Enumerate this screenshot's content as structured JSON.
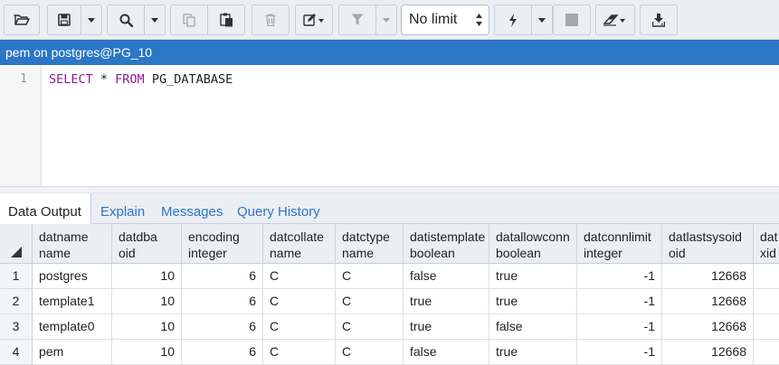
{
  "toolbar": {
    "buttons": [
      {
        "name": "open-file-button",
        "icon": "folder-open-icon"
      },
      {
        "name": "save-button",
        "icon": "floppy-icon"
      },
      {
        "name": "save-dropdown-button",
        "icon": "caret-down-icon"
      },
      {
        "name": "find-button",
        "icon": "search-icon"
      },
      {
        "name": "find-dropdown-button",
        "icon": "caret-down-icon"
      },
      {
        "name": "copy-button",
        "icon": "copy-icon"
      },
      {
        "name": "paste-button",
        "icon": "paste-icon"
      },
      {
        "name": "delete-button",
        "icon": "trash-icon"
      },
      {
        "name": "edit-button",
        "icon": "pencil-square-icon"
      },
      {
        "name": "filter-button",
        "icon": "filter-icon"
      },
      {
        "name": "filter-dropdown-button",
        "icon": "caret-down-icon"
      },
      {
        "name": "execute-button",
        "icon": "lightning-icon"
      },
      {
        "name": "execute-dropdown-button",
        "icon": "caret-down-icon"
      },
      {
        "name": "stop-button",
        "icon": "stop-icon"
      },
      {
        "name": "clear-button",
        "icon": "eraser-icon"
      },
      {
        "name": "download-button",
        "icon": "download-icon"
      }
    ],
    "limit_value": "No limit"
  },
  "connection": {
    "label": "pem on postgres@PG_10"
  },
  "editor": {
    "line_number": "1",
    "tokens": {
      "kw1": "SELECT",
      "mid": " * ",
      "kw2": "FROM",
      "rest": " PG_DATABASE"
    }
  },
  "tabs": [
    {
      "label": "Data Output",
      "active": true
    },
    {
      "label": "Explain",
      "active": false
    },
    {
      "label": "Messages",
      "active": false
    },
    {
      "label": "Query History",
      "active": false
    }
  ],
  "grid": {
    "columns": [
      {
        "name": "datname",
        "type": "name"
      },
      {
        "name": "datdba",
        "type": "oid"
      },
      {
        "name": "encoding",
        "type": "integer"
      },
      {
        "name": "datcollate",
        "type": "name"
      },
      {
        "name": "datctype",
        "type": "name"
      },
      {
        "name": "datistemplate",
        "type": "boolean"
      },
      {
        "name": "datallowconn",
        "type": "boolean"
      },
      {
        "name": "datconnlimit",
        "type": "integer"
      },
      {
        "name": "datlastsysoid",
        "type": "oid"
      },
      {
        "name": "dat",
        "type": "xid"
      }
    ],
    "row_numbers": [
      "1",
      "2",
      "3",
      "4"
    ],
    "rows": [
      [
        "postgres",
        "10",
        "6",
        "C",
        "C",
        "false",
        "true",
        "-1",
        "12668",
        ""
      ],
      [
        "template1",
        "10",
        "6",
        "C",
        "C",
        "true",
        "true",
        "-1",
        "12668",
        ""
      ],
      [
        "template0",
        "10",
        "6",
        "C",
        "C",
        "true",
        "false",
        "-1",
        "12668",
        ""
      ],
      [
        "pem",
        "10",
        "6",
        "C",
        "C",
        "false",
        "true",
        "-1",
        "12668",
        ""
      ]
    ]
  },
  "colors": {
    "accent": "#2c76c6",
    "keyword": "#8e1b94",
    "toolbar_bg": "#ebeef3"
  }
}
